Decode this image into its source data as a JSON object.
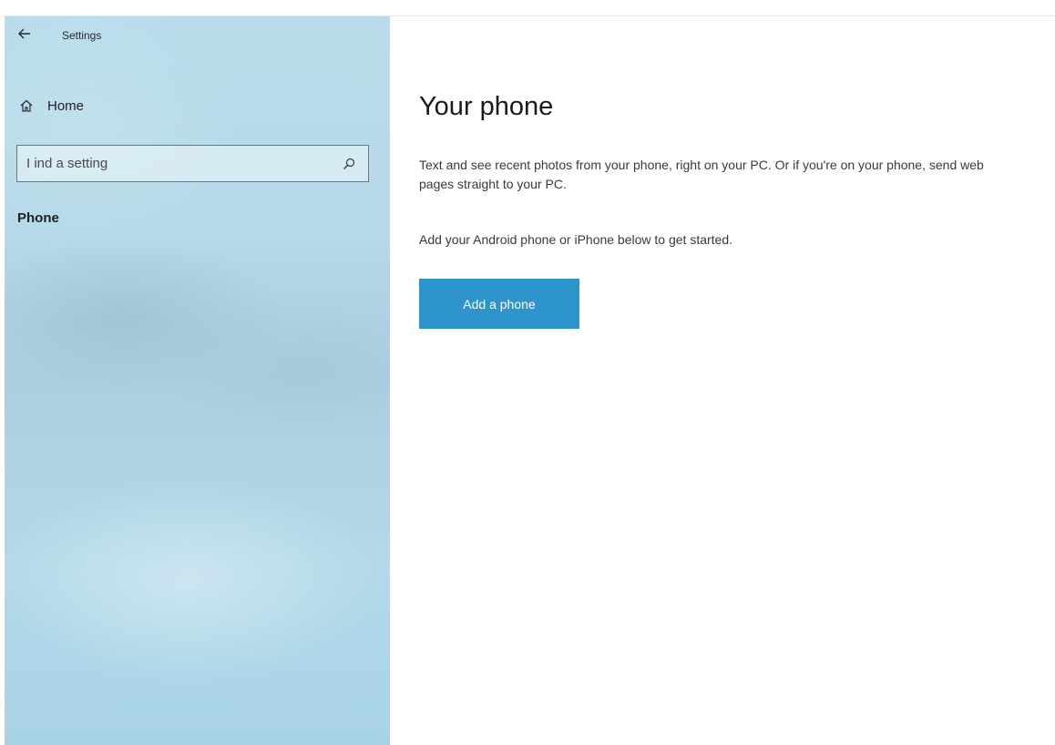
{
  "window": {
    "title": "Settings",
    "back_icon": "back-arrow-icon"
  },
  "sidebar": {
    "home": {
      "icon": "home-icon",
      "label": "Home"
    },
    "search": {
      "placeholder": "Find a setting",
      "displayed_text": "I ind a setting",
      "icon": "search-icon"
    },
    "section_label": "Phone"
  },
  "main": {
    "title": "Your phone",
    "description": "Text and see recent photos from your phone, right on your PC. Or if you're on your phone, send web pages straight to your PC.",
    "instruction": "Add your Android phone or iPhone below to get started.",
    "add_button_label": "Add a phone"
  },
  "colors": {
    "accent": "#2e94cc",
    "sidebar_bg": "#b6d8e8"
  }
}
